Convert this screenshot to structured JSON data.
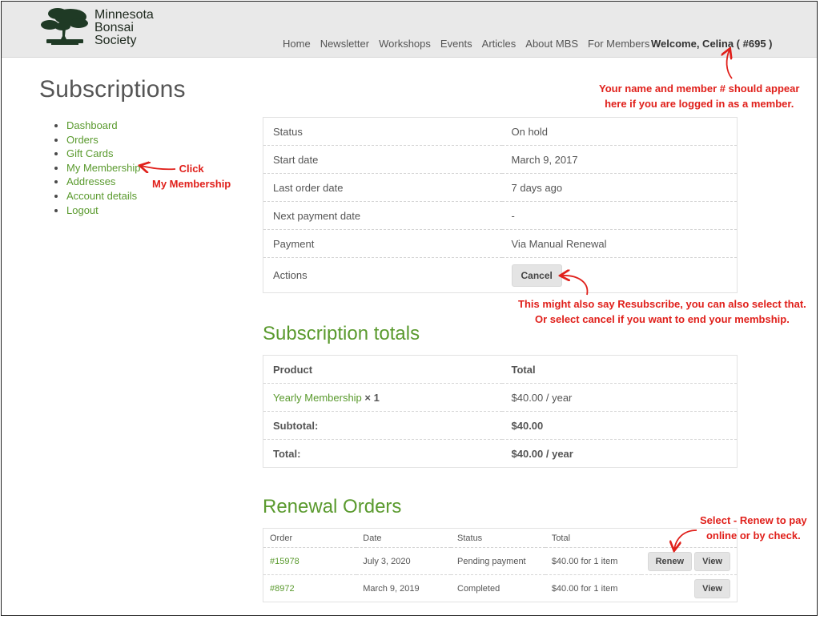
{
  "logo": {
    "line1": "Minnesota",
    "line2": "Bonsai",
    "line3": "Society"
  },
  "nav": {
    "items": [
      "Home",
      "Newsletter",
      "Workshops",
      "Events",
      "Articles",
      "About MBS",
      "For Members"
    ]
  },
  "welcome": "Welcome, Celina ( #695 )",
  "page_title": "Subscriptions",
  "account_nav": [
    "Dashboard",
    "Orders",
    "Gift Cards",
    "My Membership",
    "Addresses",
    "Account details",
    "Logout"
  ],
  "subscription": {
    "rows": [
      {
        "label": "Status",
        "value": "On hold"
      },
      {
        "label": "Start date",
        "value": "March 9, 2017"
      },
      {
        "label": "Last order date",
        "value": "7 days ago"
      },
      {
        "label": "Next payment date",
        "value": "-"
      },
      {
        "label": "Payment",
        "value": "Via Manual Renewal"
      }
    ],
    "actions_label": "Actions",
    "cancel_label": "Cancel"
  },
  "totals": {
    "title": "Subscription totals",
    "headers": [
      "Product",
      "Total"
    ],
    "product_name": "Yearly Membership",
    "product_qty": "× 1",
    "product_total": "$40.00 / year",
    "subtotal_label": "Subtotal:",
    "subtotal_value": "$40.00",
    "total_label": "Total:",
    "total_value": "$40.00 / year"
  },
  "renewal": {
    "title": "Renewal Orders",
    "headers": [
      "Order",
      "Date",
      "Status",
      "Total"
    ],
    "orders": [
      {
        "order": "#15978",
        "date": "July 3, 2020",
        "status": "Pending payment",
        "total": "$40.00 for 1 item",
        "renew": "Renew",
        "view": "View"
      },
      {
        "order": "#8972",
        "date": "March 9, 2019",
        "status": "Completed",
        "total": "$40.00 for 1 item",
        "view": "View"
      }
    ]
  },
  "annotations": {
    "welcome_line1": "Your name and member # should appear",
    "welcome_line2": "here if you are logged in as a member.",
    "click_line1": "Click",
    "click_line2": "My Membership",
    "cancel_line1": "This might also say Resubscribe, you can also select that.",
    "cancel_line2": "Or select cancel if you want to end your membship.",
    "renew_line1": "Select - Renew to pay",
    "renew_line2": "online or by check."
  },
  "colors": {
    "accent_green": "#5a9a2e",
    "annotation_red": "#e0201b",
    "header_bg": "#e9e9e9"
  }
}
